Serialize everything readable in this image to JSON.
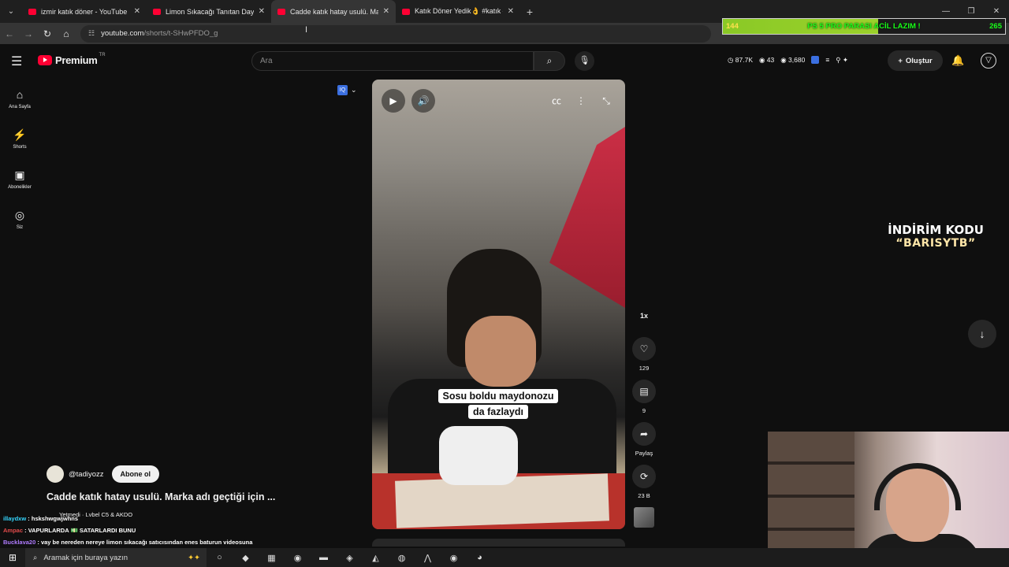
{
  "browser": {
    "tabs": [
      {
        "title": "izmir katık döner - YouTube",
        "active": false
      },
      {
        "title": "Limon Sıkacağı Tanıtan Dayımız",
        "active": false
      },
      {
        "title": "Cadde katık hatay usulü. Marka",
        "active": true
      },
      {
        "title": "Katık Döner Yedik👌 #katık #dö",
        "active": false
      }
    ],
    "url_host": "youtube.com",
    "url_path": "/shorts/t-SHwPFDO_g"
  },
  "stream_overlay": {
    "left_value": "144",
    "goal_text": "PS 5 PRO PARASI ACİL LAZIM !",
    "right_value": "265"
  },
  "header": {
    "logo_text": "Premium",
    "region": "TR",
    "search_placeholder": "Ara",
    "stats": {
      "views": "87.7K",
      "viewers": "43",
      "count": "3,680"
    },
    "create_label": "Oluştur"
  },
  "sidebar": {
    "items": [
      {
        "label": "Ana Sayfa",
        "icon": "home-icon"
      },
      {
        "label": "Shorts",
        "icon": "shorts-icon"
      },
      {
        "label": "Abonelikler",
        "icon": "subscriptions-icon"
      },
      {
        "label": "Siz",
        "icon": "you-icon"
      }
    ]
  },
  "video": {
    "caption_line1": "Sosu boldu maydonozu",
    "caption_line2": "da fazlaydı"
  },
  "actions": {
    "speed": "1x",
    "likes": "129",
    "comments": "9",
    "share_label": "Paylaş",
    "remix_count": "23 B"
  },
  "channel": {
    "name": "@tadiyozz",
    "subscribe_label": "Abone ol",
    "title": "Cadde katık hatay usulü. Marka adı geçtiği için ...",
    "music": "Yetmedi · Lvbel C5 & AKDO"
  },
  "chat": [
    {
      "user": "illaydxw",
      "message": ": hskshwgwjwhns"
    },
    {
      "user": "Ampac",
      "message": ": VAPURLARDA 💵 SATARLARDI BUNU"
    },
    {
      "user": "Bucklava20",
      "message": ": vay be nereden nereye limon sıkacağı satıcısından enes baturun videosuna"
    }
  ],
  "promo": {
    "line1": "İNDİRİM KODU",
    "line2": "“BARISYTB”"
  },
  "taskbar": {
    "search_placeholder": "Aramak için buraya yazın"
  }
}
